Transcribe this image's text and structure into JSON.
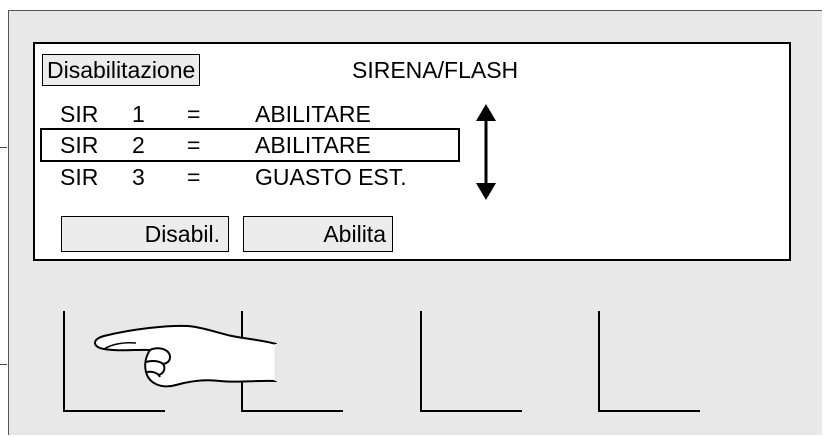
{
  "screen": {
    "label": "Disabilitazione",
    "title": "SIRENA/FLASH"
  },
  "list": {
    "rows": [
      {
        "prefix": "SIR",
        "number": "1",
        "eq": "=",
        "value": "ABILITARE"
      },
      {
        "prefix": "SIR",
        "number": "2",
        "eq": "=",
        "value": "ABILITARE"
      },
      {
        "prefix": "SIR",
        "number": "3",
        "eq": "=",
        "value": "GUASTO EST."
      }
    ],
    "selected_index": 1,
    "scroll_icon": "up-down-arrow-icon"
  },
  "buttons": {
    "disable_label": "Disabil.",
    "enable_label": "Abilita"
  },
  "softkeys": {
    "count": 4,
    "pointer_icon": "pointing-hand-icon"
  },
  "colors": {
    "panel_bg": "#e8e8e8",
    "display_bg": "#ffffff",
    "button_bg": "#ececec",
    "line": "#000000"
  }
}
